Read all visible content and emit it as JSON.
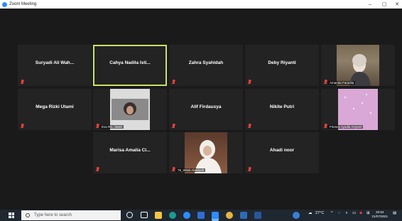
{
  "window": {
    "title": "Zoom Meeting",
    "minimize": "–",
    "maximize": "▢",
    "close": "✕"
  },
  "participants": [
    {
      "name": "Suryadi Ali Wah...",
      "muted": true,
      "video": false
    },
    {
      "name": "Cahya Nadila Isti...",
      "muted": false,
      "video": false,
      "active_speaker": true
    },
    {
      "name": "Zahra Syahidah",
      "muted": true,
      "video": false
    },
    {
      "name": "Deby Riyanti",
      "muted": true,
      "video": false
    },
    {
      "name": "Amanda Faradila",
      "muted": true,
      "video": true
    },
    {
      "name": "Mega Rizki Utami",
      "muted": true,
      "video": false
    },
    {
      "name": "Eva Ra...tiwati",
      "muted": true,
      "video": true
    },
    {
      "name": "Alif Firdausya",
      "muted": true,
      "video": false
    },
    {
      "name": "Nikite Putri",
      "muted": true,
      "video": false
    },
    {
      "name": "Friesca Ayudia Ariyanti",
      "muted": true,
      "video": true
    },
    {
      "name": "Marisa Amalia Ci...",
      "muted": true,
      "video": false
    },
    {
      "name": "76_Wiwit Alawiyah",
      "muted": true,
      "video": true
    },
    {
      "name": "Ahadi noor",
      "muted": true,
      "video": false
    }
  ],
  "taskbar": {
    "search_placeholder": "Type here to search",
    "weather": "27°C",
    "time": "20:54",
    "date": "21/07/2021"
  },
  "colors": {
    "active_speaker_border": "#c9e265",
    "muted_mic": "#e8413a",
    "tile_bg": "#232323"
  }
}
